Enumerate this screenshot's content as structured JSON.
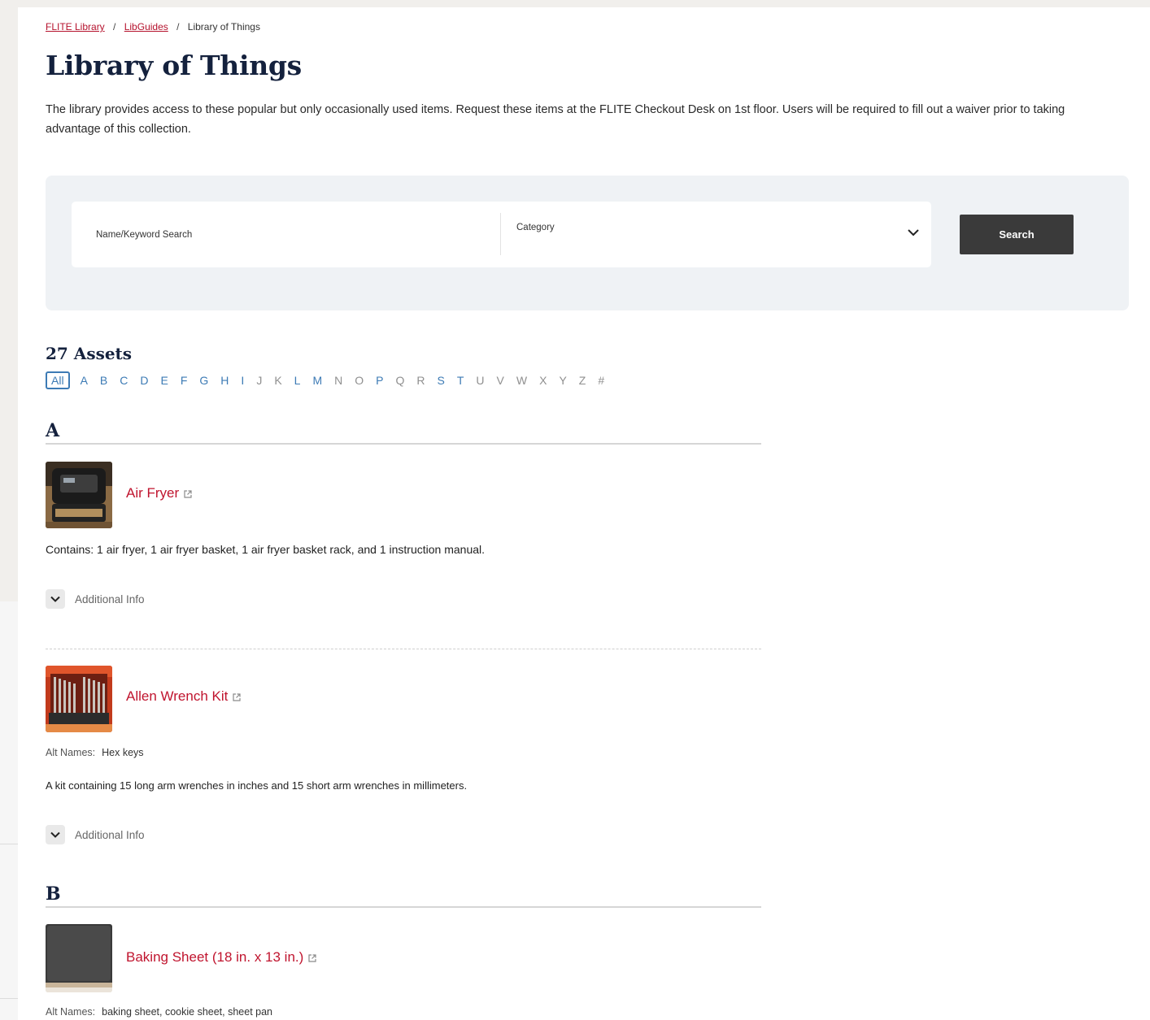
{
  "breadcrumb": {
    "items": [
      "FLITE Library",
      "LibGuides",
      "Library of Things"
    ],
    "separator": "/"
  },
  "page": {
    "title": "Library of Things",
    "intro": "The library provides access to these popular but only occasionally used items. Request these items at the FLITE Checkout Desk on 1st floor. Users will be required to fill out a waiver prior to taking advantage of this collection."
  },
  "search": {
    "keyword_placeholder": "Name/Keyword Search",
    "category_label": "Category",
    "button_label": "Search"
  },
  "results": {
    "count_label": "27 Assets",
    "az": [
      {
        "label": "All",
        "state": "active"
      },
      {
        "label": "A",
        "state": "link"
      },
      {
        "label": "B",
        "state": "link"
      },
      {
        "label": "C",
        "state": "link"
      },
      {
        "label": "D",
        "state": "link"
      },
      {
        "label": "E",
        "state": "link"
      },
      {
        "label": "F",
        "state": "link"
      },
      {
        "label": "G",
        "state": "link"
      },
      {
        "label": "H",
        "state": "link"
      },
      {
        "label": "I",
        "state": "link"
      },
      {
        "label": "J",
        "state": "dim"
      },
      {
        "label": "K",
        "state": "dim"
      },
      {
        "label": "L",
        "state": "link"
      },
      {
        "label": "M",
        "state": "link"
      },
      {
        "label": "N",
        "state": "dim"
      },
      {
        "label": "O",
        "state": "dim"
      },
      {
        "label": "P",
        "state": "link"
      },
      {
        "label": "Q",
        "state": "dim"
      },
      {
        "label": "R",
        "state": "dim"
      },
      {
        "label": "S",
        "state": "link"
      },
      {
        "label": "T",
        "state": "link"
      },
      {
        "label": "U",
        "state": "dim"
      },
      {
        "label": "V",
        "state": "dim"
      },
      {
        "label": "W",
        "state": "dim"
      },
      {
        "label": "X",
        "state": "dim"
      },
      {
        "label": "Y",
        "state": "dim"
      },
      {
        "label": "Z",
        "state": "dim"
      },
      {
        "label": "#",
        "state": "dim"
      }
    ],
    "sections": [
      {
        "letter": "A",
        "items": [
          {
            "title": "Air Fryer",
            "description": "Contains: 1 air fryer, 1 air fryer basket, 1 air fryer basket rack, and 1 instruction manual.",
            "more_label": "Additional Info"
          },
          {
            "title": "Allen Wrench Kit",
            "alt_names_label": "Alt Names:",
            "alt_names": "Hex keys",
            "description": "A kit containing 15 long arm wrenches in inches and 15 short arm wrenches in millimeters.",
            "more_label": "Additional Info"
          }
        ]
      },
      {
        "letter": "B",
        "items": [
          {
            "title": "Baking Sheet (18 in. x 13 in.)",
            "alt_names_label": "Alt Names:",
            "alt_names": "baking sheet, cookie sheet, sheet pan"
          }
        ]
      }
    ]
  },
  "colors": {
    "link": "#b5122d",
    "title": "#c0142e",
    "heading": "#14213d",
    "az_active": "#3d7bb5",
    "az_dim": "#8f8f8f",
    "button_bg": "#3a3a3a",
    "panel_bg": "#eff2f5"
  },
  "icons": {
    "external": "external-link-icon",
    "toggle": "chevron-down-icon",
    "select": "chevron-down-icon"
  }
}
